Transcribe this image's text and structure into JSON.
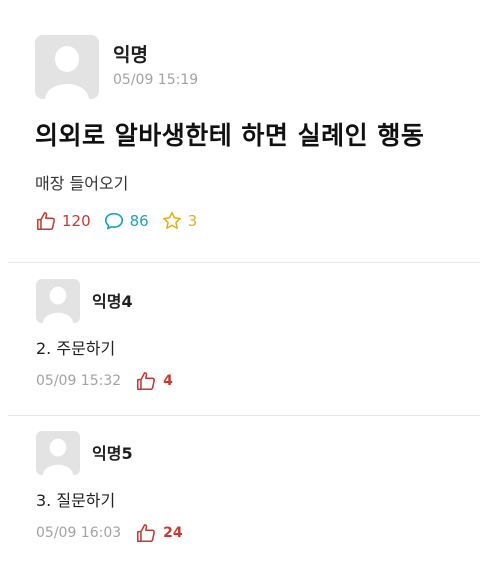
{
  "post": {
    "author": "익명",
    "time": "05/09 15:19",
    "title": "의외로 알바생한테 하면 실례인 행동",
    "body": "매장 들어오기",
    "likes": "120",
    "comments": "86",
    "scraps": "3"
  },
  "comments": [
    {
      "author": "익명4",
      "text": "2. 주문하기",
      "time": "05/09 15:32",
      "likes": "4"
    },
    {
      "author": "익명5",
      "text": "3. 질문하기",
      "time": "05/09 16:03",
      "likes": "24"
    }
  ],
  "colors": {
    "like": "#c83a2f",
    "comment": "#1aa4b4",
    "scrap": "#e3b01a",
    "meta_gray": "#a3a3a3",
    "avatar_bg": "#e3e3e3"
  },
  "icons": {
    "like": "thumbs-up-icon",
    "comment": "speech-bubble-icon",
    "scrap": "star-icon",
    "avatar": "default-avatar-icon"
  }
}
